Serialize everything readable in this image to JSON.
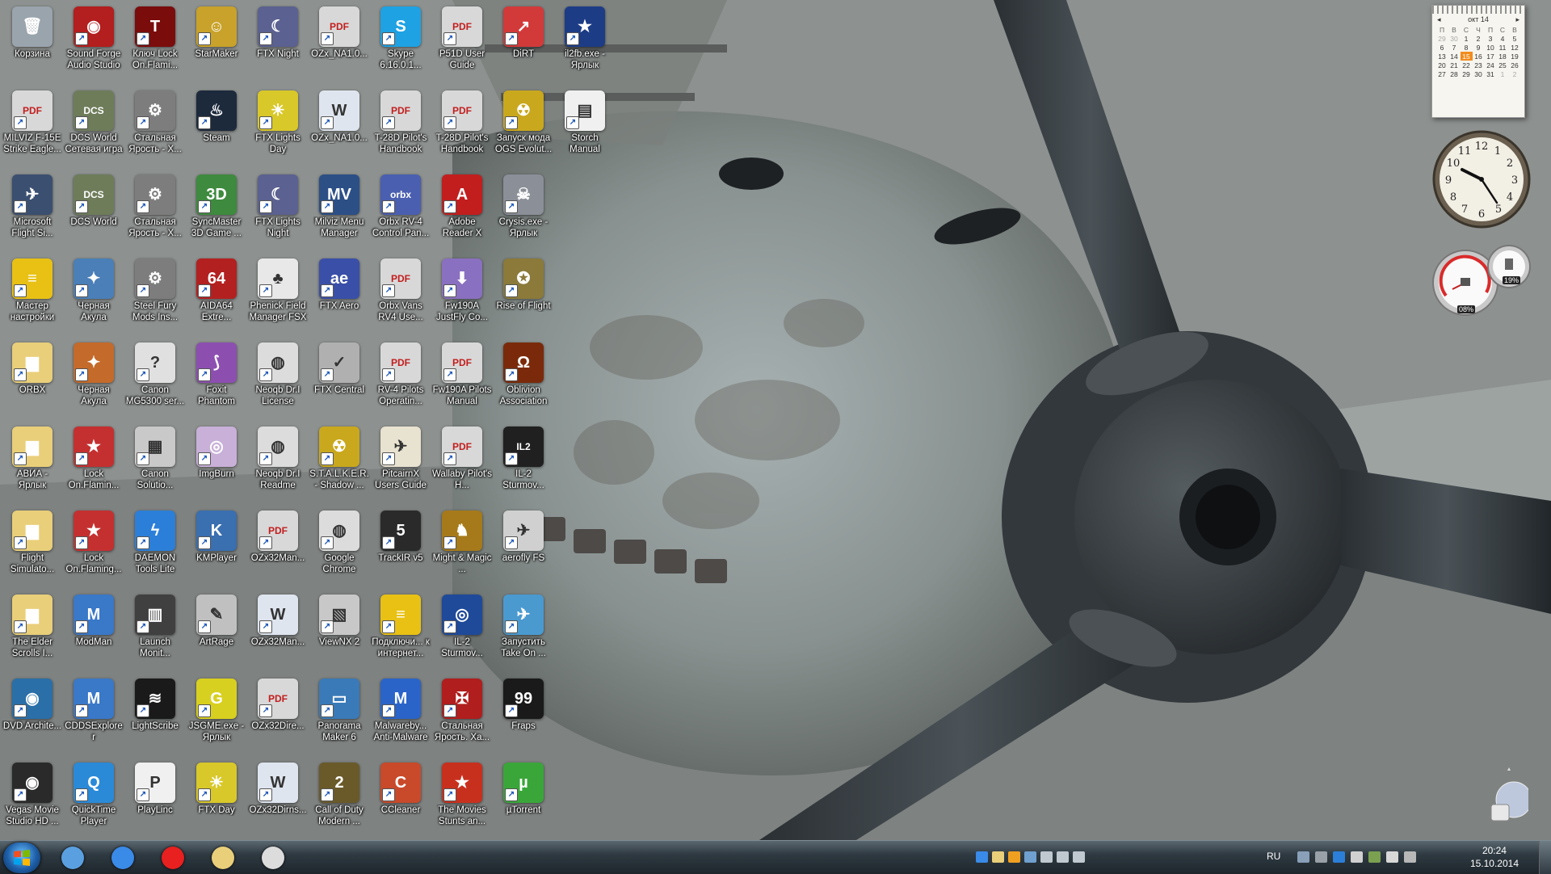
{
  "desktop_icons": [
    {
      "label": "Корзина",
      "icon": "recycle-bin-icon",
      "color": "#9aa4ad",
      "glyph": "🗑"
    },
    {
      "label": "Sound Forge Audio Studio",
      "icon": "sound-forge-icon",
      "color": "#b31e1e",
      "glyph": "◉"
    },
    {
      "label": "Ключ Lock On.Flami...",
      "icon": "lock-on-icon",
      "color": "#7a0c0c",
      "glyph": "T"
    },
    {
      "label": "StarMaker",
      "icon": "starmaker-icon",
      "color": "#c8a22a",
      "glyph": "☺"
    },
    {
      "label": "FTX Night",
      "icon": "ftx-night-icon",
      "color": "#5b6190",
      "glyph": "☾"
    },
    {
      "label": "OZx_NA1.0...",
      "icon": "pdf-icon",
      "color": "#d8d8d8",
      "glyph": "PDF"
    },
    {
      "label": "Skype 6.16.0.1...",
      "icon": "skype-icon",
      "color": "#1ea2e3",
      "glyph": "S"
    },
    {
      "label": "P51D User Guide",
      "icon": "pdf-icon",
      "color": "#d8d8d8",
      "glyph": "PDF"
    },
    {
      "label": "DiRT",
      "icon": "dirt-icon",
      "color": "#d23a3a",
      "glyph": "↗"
    },
    {
      "label": "il2fb.exe - Ярлык",
      "icon": "il2fb-icon",
      "color": "#1d3c86",
      "glyph": "★"
    },
    {
      "label": "MILVIZ F-15E Strike Eagle...",
      "icon": "pdf-icon",
      "color": "#d8d8d8",
      "glyph": "PDF"
    },
    {
      "label": "DCS World Сетевая игра",
      "icon": "dcs-icon",
      "color": "#6e7c5a",
      "glyph": "DCS"
    },
    {
      "label": "Стальная Ярость - Х...",
      "icon": "gear-icon",
      "color": "#7d7d7d",
      "glyph": "⚙"
    },
    {
      "label": "Steam",
      "icon": "steam-icon",
      "color": "#1d2a3c",
      "glyph": "♨"
    },
    {
      "label": "FTX Lights Day",
      "icon": "ftx-day-icon",
      "color": "#d9c82a",
      "glyph": "☀"
    },
    {
      "label": "OZx_NA1.0...",
      "icon": "word-doc-icon",
      "color": "#dfe5ef",
      "glyph": "W"
    },
    {
      "label": "T-28D Pilot's Handbook",
      "icon": "pdf-icon",
      "color": "#d8d8d8",
      "glyph": "PDF"
    },
    {
      "label": "T-28D Pilot's Handbook",
      "icon": "pdf-icon",
      "color": "#d8d8d8",
      "glyph": "PDF"
    },
    {
      "label": "Запуск мода OGS Evolut...",
      "icon": "radiation-icon",
      "color": "#c9a81e",
      "glyph": "☢"
    },
    {
      "label": "Storch Manual",
      "icon": "document-icon",
      "color": "#f0f0f0",
      "glyph": "▤"
    },
    {
      "label": "Microsoft Flight Si...",
      "icon": "flight-sim-icon",
      "color": "#3b4f70",
      "glyph": "✈"
    },
    {
      "label": "DCS World",
      "icon": "dcs-icon",
      "color": "#6e7c5a",
      "glyph": "DCS"
    },
    {
      "label": "Стальная Ярость - Х...",
      "icon": "gear-icon",
      "color": "#7d7d7d",
      "glyph": "⚙"
    },
    {
      "label": "SyncMaster 3D Game ...",
      "icon": "syncmaster-icon",
      "color": "#3e8a3e",
      "glyph": "3D"
    },
    {
      "label": "FTX Lights Night",
      "icon": "ftx-night-icon",
      "color": "#5b6190",
      "glyph": "☾"
    },
    {
      "label": "Milviz Menu Manager",
      "icon": "milviz-icon",
      "color": "#2c4f86",
      "glyph": "MV"
    },
    {
      "label": "Orbx RV-4 Control Pan...",
      "icon": "orbx-icon",
      "color": "#4a5fb0",
      "glyph": "orbx"
    },
    {
      "label": "Adobe Reader X",
      "icon": "adobe-reader-icon",
      "color": "#c21e1e",
      "glyph": "A"
    },
    {
      "label": "Crysis.exe - Ярлык",
      "icon": "crysis-icon",
      "color": "#8a8f98",
      "glyph": "☠"
    },
    {
      "label": "Мастер настройки",
      "icon": "beeline-icon",
      "color": "#e8c114",
      "glyph": "≡"
    },
    {
      "label": "Черная Акула",
      "icon": "black-shark-icon",
      "color": "#4a7fb8",
      "glyph": "✦"
    },
    {
      "label": "Steel Fury Mods Ins...",
      "icon": "gear-icon",
      "color": "#7d7d7d",
      "glyph": "⚙"
    },
    {
      "label": "AIDA64 Extre...",
      "icon": "aida64-icon",
      "color": "#b32020",
      "glyph": "64"
    },
    {
      "label": "Phenick Field Manager FSX",
      "icon": "palm-icon",
      "color": "#e8e8e8",
      "glyph": "♣"
    },
    {
      "label": "FTX Aero",
      "icon": "ftx-aero-icon",
      "color": "#3a4fa8",
      "glyph": "ae"
    },
    {
      "label": "Orbx Vans RV4 Use...",
      "icon": "pdf-icon",
      "color": "#d8d8d8",
      "glyph": "PDF"
    },
    {
      "label": "Fw190A JustFly Co...",
      "icon": "installer-icon",
      "color": "#8a70c0",
      "glyph": "⬇"
    },
    {
      "label": "Rise of Flight",
      "icon": "rise-of-flight-icon",
      "color": "#8b7a3a",
      "glyph": "✪"
    },
    {
      "label": "ORBX",
      "icon": "folder-icon",
      "color": "#e9cf7a",
      "glyph": "▆"
    },
    {
      "label": "Черная Акула",
      "icon": "black-shark-icon",
      "color": "#c46a2a",
      "glyph": "✦"
    },
    {
      "label": "Canon MG5300 ser...",
      "icon": "canon-icon",
      "color": "#e0e0e0",
      "glyph": "?"
    },
    {
      "label": "Foxit Phantom",
      "icon": "foxit-icon",
      "color": "#8c4fb0",
      "glyph": "⟆"
    },
    {
      "label": "Neoqb Dr.I License",
      "icon": "chrome-icon",
      "color": "#dcdcdc",
      "glyph": "◍"
    },
    {
      "label": "FTX Central",
      "icon": "ftx-central-icon",
      "color": "#b0b0b0",
      "glyph": "✓"
    },
    {
      "label": "RV-4 Pilots Operatin...",
      "icon": "pdf-icon",
      "color": "#d8d8d8",
      "glyph": "PDF"
    },
    {
      "label": "Fw190A Pilots Manual",
      "icon": "pdf-icon",
      "color": "#d8d8d8",
      "glyph": "PDF"
    },
    {
      "label": "Oblivion Association",
      "icon": "oblivion-icon",
      "color": "#7a2a0a",
      "glyph": "Ω"
    },
    {
      "label": "АВИА - Ярлык",
      "icon": "folder-icon",
      "color": "#e9cf7a",
      "glyph": "▆"
    },
    {
      "label": "Lock On.Flamin...",
      "icon": "lock-on-2-icon",
      "color": "#c43030",
      "glyph": "★"
    },
    {
      "label": "Canon Solutio...",
      "icon": "canon-solution-icon",
      "color": "#c9c9c9",
      "glyph": "▦"
    },
    {
      "label": "ImgBurn",
      "icon": "imgburn-icon",
      "color": "#c8b0d8",
      "glyph": "◎"
    },
    {
      "label": "Neoqb Dr.I Readme",
      "icon": "chrome-icon",
      "color": "#dcdcdc",
      "glyph": "◍"
    },
    {
      "label": "S.T.A.L.K.E.R. - Shadow ...",
      "icon": "radiation-icon",
      "color": "#c9a81e",
      "glyph": "☢"
    },
    {
      "label": "PitcairnX Users Guide",
      "icon": "pitcairn-icon",
      "color": "#e8e2d0",
      "glyph": "✈"
    },
    {
      "label": "Wallaby Pilot's H...",
      "icon": "pdf-icon",
      "color": "#d8d8d8",
      "glyph": "PDF"
    },
    {
      "label": "IL-2 Sturmov...",
      "icon": "il2-icon",
      "color": "#202020",
      "glyph": "IL2"
    },
    {
      "label": "Flight Simulato...",
      "icon": "folder-icon",
      "color": "#e9cf7a",
      "glyph": "▆"
    },
    {
      "label": "Lock On.Flaming...",
      "icon": "lock-on-2-icon",
      "color": "#c43030",
      "glyph": "★"
    },
    {
      "label": "DAEMON Tools Lite",
      "icon": "daemon-tools-icon",
      "color": "#2c7fd8",
      "glyph": "ϟ"
    },
    {
      "label": "KMPlayer",
      "icon": "kmplayer-icon",
      "color": "#3a6fb0",
      "glyph": "K"
    },
    {
      "label": "OZx32Man...",
      "icon": "pdf-icon",
      "color": "#d8d8d8",
      "glyph": "PDF"
    },
    {
      "label": "Google Chrome",
      "icon": "chrome-icon",
      "color": "#dcdcdc",
      "glyph": "◍"
    },
    {
      "label": "TrackIR v5",
      "icon": "trackir-icon",
      "color": "#2a2a2a",
      "glyph": "5"
    },
    {
      "label": "Might & Magic ...",
      "icon": "might-magic-icon",
      "color": "#a67a1a",
      "glyph": "♞"
    },
    {
      "label": "aerofly FS",
      "icon": "aerofly-icon",
      "color": "#d0d0d0",
      "glyph": "✈"
    },
    {
      "label": "The Elder Scrolls I...",
      "icon": "folder-icon",
      "color": "#e9cf7a",
      "glyph": "▆"
    },
    {
      "label": "ModMan",
      "icon": "modman-icon",
      "color": "#3a78c8",
      "glyph": "M"
    },
    {
      "label": "Launch Monit...",
      "icon": "launch-monitor-icon",
      "color": "#404040",
      "glyph": "▥"
    },
    {
      "label": "ArtRage",
      "icon": "artrage-icon",
      "color": "#c0c0c0",
      "glyph": "✎"
    },
    {
      "label": "OZx32Man...",
      "icon": "word-doc-icon",
      "color": "#dfe5ef",
      "glyph": "W"
    },
    {
      "label": "ViewNX 2",
      "icon": "viewnx-icon",
      "color": "#c8c8c8",
      "glyph": "▧"
    },
    {
      "label": "Подключи... к интернет...",
      "icon": "beeline-icon",
      "color": "#e8c114",
      "glyph": "≡"
    },
    {
      "label": "IL-2 Sturmov...",
      "icon": "roundel-icon",
      "color": "#1f4a9a",
      "glyph": "◎"
    },
    {
      "label": "Запустить Take On ...",
      "icon": "take-on-icon",
      "color": "#4a9ad0",
      "glyph": "✈"
    },
    {
      "label": "DVD Archite...",
      "icon": "dvd-icon",
      "color": "#2a6fa8",
      "glyph": "◉"
    },
    {
      "label": "CDDSExplorer",
      "icon": "modman-icon",
      "color": "#3a78c8",
      "glyph": "M"
    },
    {
      "label": "LightScribe",
      "icon": "lightscribe-icon",
      "color": "#1a1a1a",
      "glyph": "≋"
    },
    {
      "label": "JSGME.exe - Ярлык",
      "icon": "jsgme-icon",
      "color": "#d8d020",
      "glyph": "G"
    },
    {
      "label": "OZx32Dire...",
      "icon": "pdf-icon",
      "color": "#d8d8d8",
      "glyph": "PDF"
    },
    {
      "label": "Panorama Maker 6",
      "icon": "panorama-icon",
      "color": "#3a7ab8",
      "glyph": "▭"
    },
    {
      "label": "Malwareby... Anti-Malware",
      "icon": "malwarebytes-icon",
      "color": "#2a64c8",
      "glyph": "M"
    },
    {
      "label": "Стальная Ярость. Ха...",
      "icon": "steel-fury-icon",
      "color": "#b01e1e",
      "glyph": "✠"
    },
    {
      "label": "Fraps",
      "icon": "fraps-icon",
      "color": "#1a1a1a",
      "glyph": "99"
    },
    {
      "label": "Vegas Movie Studio HD ...",
      "icon": "vegas-icon",
      "color": "#2a2a2a",
      "glyph": "◉"
    },
    {
      "label": "QuickTime Player",
      "icon": "quicktime-icon",
      "color": "#2a8ad8",
      "glyph": "Q"
    },
    {
      "label": "PlayLinc",
      "icon": "playlinc-icon",
      "color": "#f0f0f0",
      "glyph": "P"
    },
    {
      "label": "FTX Day",
      "icon": "ftx-day-icon",
      "color": "#d9c82a",
      "glyph": "☀"
    },
    {
      "label": "OZx32Dirns...",
      "icon": "word-doc-icon",
      "color": "#dfe5ef",
      "glyph": "W"
    },
    {
      "label": "Call of Duty Modern ...",
      "icon": "cod-icon",
      "color": "#6a5a2a",
      "glyph": "2"
    },
    {
      "label": "CCleaner",
      "icon": "ccleaner-icon",
      "color": "#c84a2a",
      "glyph": "C"
    },
    {
      "label": "The Movies Stunts an...",
      "icon": "the-movies-icon",
      "color": "#c8301e",
      "glyph": "★"
    },
    {
      "label": "µTorrent",
      "icon": "utorrent-icon",
      "color": "#3aa63a",
      "glyph": "µ"
    }
  ],
  "calendar": {
    "month": "окт 14",
    "weekdays": [
      "П",
      "В",
      "С",
      "Ч",
      "П",
      "С",
      "В"
    ],
    "weeks": [
      [
        "29",
        "30",
        "1",
        "2",
        "3",
        "4",
        "5"
      ],
      [
        "6",
        "7",
        "8",
        "9",
        "10",
        "11",
        "12"
      ],
      [
        "13",
        "14",
        "15",
        "16",
        "17",
        "18",
        "19"
      ],
      [
        "20",
        "21",
        "22",
        "23",
        "24",
        "25",
        "26"
      ],
      [
        "27",
        "28",
        "29",
        "30",
        "31",
        "1",
        "2"
      ]
    ],
    "today": "15"
  },
  "cpu_meter": {
    "cpu": "08%",
    "ram": "19%"
  },
  "taskbar": {
    "pinned": [
      {
        "name": "taskbar-mediaplayer",
        "icon": "media-player-icon",
        "color": "#5aa0e0"
      },
      {
        "name": "taskbar-ie",
        "icon": "internet-explorer-icon",
        "color": "#3a8ae8"
      },
      {
        "name": "taskbar-yandex",
        "icon": "yandex-browser-icon",
        "color": "#e82020"
      },
      {
        "name": "taskbar-explorer",
        "icon": "folder-icon",
        "color": "#e9cf7a"
      },
      {
        "name": "taskbar-chrome",
        "icon": "chrome-icon",
        "color": "#dcdcdc"
      }
    ],
    "language": "RU",
    "time": "20:24",
    "date": "15.10.2014"
  }
}
